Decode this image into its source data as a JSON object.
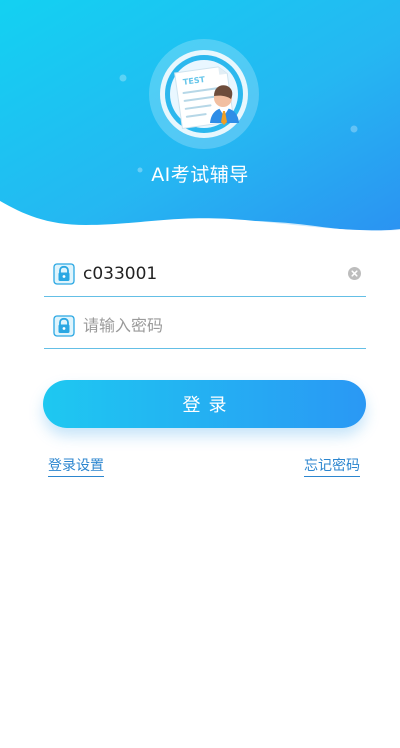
{
  "app": {
    "title": "AI考试辅导",
    "logo_text": "TEST"
  },
  "form": {
    "username": {
      "value": "c033001",
      "placeholder": ""
    },
    "password": {
      "value": "",
      "placeholder": "请输入密码"
    },
    "login_label": "登录"
  },
  "links": {
    "login_settings": "登录设置",
    "forgot_password": "忘记密码"
  },
  "colors": {
    "header_start": "#1ec8f1",
    "header_end": "#2a98f4",
    "accent": "#2c86cf",
    "field_line": "#64bfe6"
  },
  "icons": {
    "logo": "exam-document-avatar-icon",
    "username_field": "lock-icon",
    "password_field": "lock-icon",
    "clear_username": "clear-icon"
  }
}
